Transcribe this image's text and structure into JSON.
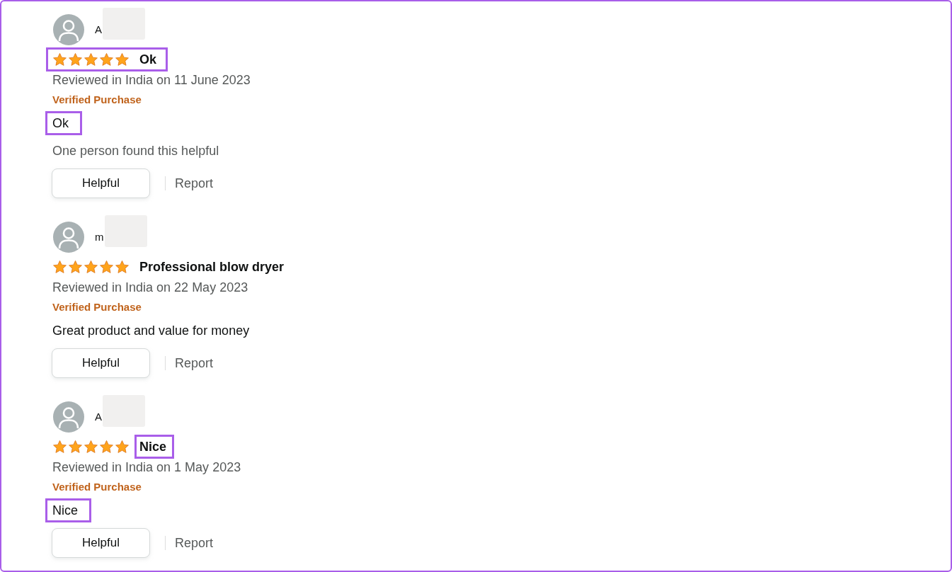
{
  "reviews": [
    {
      "author": "A",
      "author_redacted": true,
      "stars": 5,
      "rating_row_highlighted": true,
      "title": "Ok",
      "title_highlighted": false,
      "date": "Reviewed in India on 11 June 2023",
      "badge": "Verified Purchase",
      "body": "Ok",
      "body_highlighted": true,
      "helpful_count": "One person found this helpful",
      "helpful_button": "Helpful",
      "report_link": "Report"
    },
    {
      "author": "m",
      "author_redacted": true,
      "stars": 5,
      "rating_row_highlighted": false,
      "title": "Professional blow dryer",
      "title_highlighted": false,
      "date": "Reviewed in India on 22 May 2023",
      "badge": "Verified Purchase",
      "body": "Great product and value for money",
      "body_highlighted": false,
      "helpful_button": "Helpful",
      "report_link": "Report"
    },
    {
      "author": "A",
      "author_redacted": true,
      "stars": 5,
      "rating_row_highlighted": false,
      "title": "Nice",
      "title_highlighted": true,
      "date": "Reviewed in India on 1 May 2023",
      "badge": "Verified Purchase",
      "body": "Nice",
      "body_highlighted": true,
      "helpful_button": "Helpful",
      "report_link": "Report"
    }
  ]
}
